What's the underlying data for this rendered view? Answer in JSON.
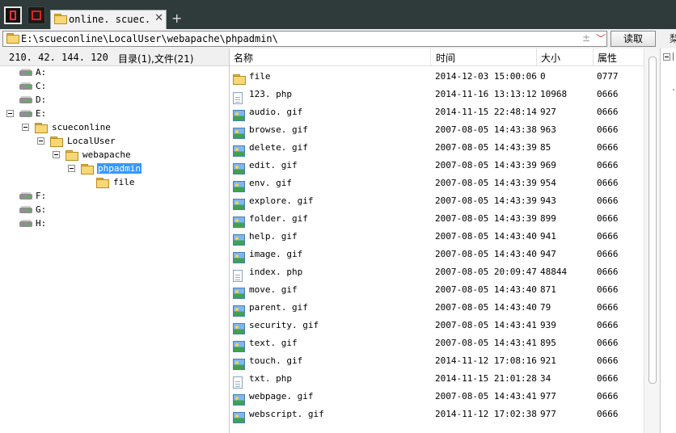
{
  "tab": {
    "title": "online. scuec. edu. cn",
    "close_glyph": "✕",
    "new_tab_glyph": "+"
  },
  "address": {
    "path": "E:\\scueconline\\LocalUser\\webapache\\phpadmin\\",
    "plusminus": "±",
    "dropdown": "﹀"
  },
  "read_button": "读取",
  "edge_char": "梨",
  "left_header": {
    "ip": "210. 42. 144. 120",
    "summary": "目录(1),文件(21)"
  },
  "columns": {
    "name": "名称",
    "time": "时间",
    "size": "大小",
    "attr": "属性"
  },
  "tree": {
    "drives": [
      "A:",
      "C:",
      "D:",
      "E:",
      "F:",
      "G:",
      "H:"
    ],
    "folders": [
      "scueconline",
      "LocalUser",
      "webapache",
      "phpadmin",
      "file"
    ]
  },
  "files": [
    {
      "name": "file",
      "time": "2014-12-03 15:00:06",
      "size": "0",
      "attr": "0777",
      "icon": "folder-icon"
    },
    {
      "name": "123. php",
      "time": "2014-11-16 13:13:12",
      "size": "10968",
      "attr": "0666",
      "icon": "php-file-icon"
    },
    {
      "name": "audio. gif",
      "time": "2014-11-15 22:48:14",
      "size": "927",
      "attr": "0666",
      "icon": "image-file-icon"
    },
    {
      "name": "browse. gif",
      "time": "2007-08-05 14:43:38",
      "size": "963",
      "attr": "0666",
      "icon": "image-file-icon"
    },
    {
      "name": "delete. gif",
      "time": "2007-08-05 14:43:39",
      "size": "85",
      "attr": "0666",
      "icon": "image-file-icon"
    },
    {
      "name": "edit. gif",
      "time": "2007-08-05 14:43:39",
      "size": "969",
      "attr": "0666",
      "icon": "image-file-icon"
    },
    {
      "name": "env. gif",
      "time": "2007-08-05 14:43:39",
      "size": "954",
      "attr": "0666",
      "icon": "image-file-icon"
    },
    {
      "name": "explore. gif",
      "time": "2007-08-05 14:43:39",
      "size": "943",
      "attr": "0666",
      "icon": "image-file-icon"
    },
    {
      "name": "folder. gif",
      "time": "2007-08-05 14:43:39",
      "size": "899",
      "attr": "0666",
      "icon": "image-file-icon"
    },
    {
      "name": "help. gif",
      "time": "2007-08-05 14:43:40",
      "size": "941",
      "attr": "0666",
      "icon": "image-file-icon"
    },
    {
      "name": "image. gif",
      "time": "2007-08-05 14:43:40",
      "size": "947",
      "attr": "0666",
      "icon": "image-file-icon"
    },
    {
      "name": "index. php",
      "time": "2007-08-05 20:09:47",
      "size": "48844",
      "attr": "0666",
      "icon": "php-file-icon"
    },
    {
      "name": "move. gif",
      "time": "2007-08-05 14:43:40",
      "size": "871",
      "attr": "0666",
      "icon": "image-file-icon"
    },
    {
      "name": "parent. gif",
      "time": "2007-08-05 14:43:40",
      "size": "79",
      "attr": "0666",
      "icon": "image-file-icon"
    },
    {
      "name": "security. gif",
      "time": "2007-08-05 14:43:41",
      "size": "939",
      "attr": "0666",
      "icon": "image-file-icon"
    },
    {
      "name": "text. gif",
      "time": "2007-08-05 14:43:41",
      "size": "895",
      "attr": "0666",
      "icon": "image-file-icon"
    },
    {
      "name": "touch. gif",
      "time": "2014-11-12 17:08:16",
      "size": "921",
      "attr": "0666",
      "icon": "image-file-icon"
    },
    {
      "name": "txt. php",
      "time": "2014-11-15 21:01:28",
      "size": "34",
      "attr": "0666",
      "icon": "php-file-icon"
    },
    {
      "name": "webpage. gif",
      "time": "2007-08-05 14:43:41",
      "size": "977",
      "attr": "0666",
      "icon": "image-file-icon"
    },
    {
      "name": "webscript. gif",
      "time": "2014-11-12 17:02:38",
      "size": "977",
      "attr": "0666",
      "icon": "image-file-icon"
    }
  ]
}
